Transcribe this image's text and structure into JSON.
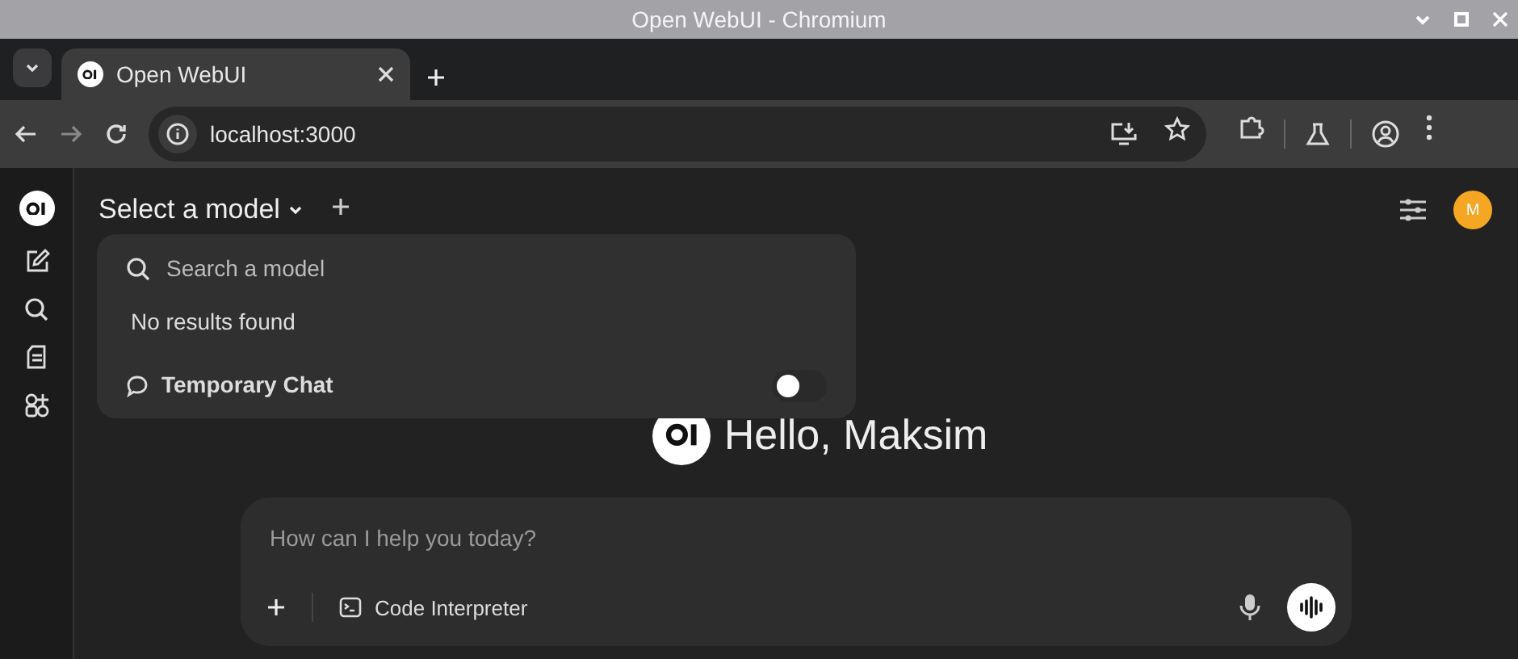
{
  "window": {
    "title": "Open WebUI - Chromium"
  },
  "tabs": [
    {
      "label": "Open WebUI",
      "selected": true
    }
  ],
  "address_bar": {
    "url": "localhost:3000"
  },
  "sidebar": {
    "items": [
      {
        "kind": "new-chat"
      },
      {
        "kind": "search"
      },
      {
        "kind": "notes"
      },
      {
        "kind": "workspace"
      }
    ]
  },
  "header": {
    "model_selector": "Select a model",
    "avatar": "M"
  },
  "model_menu": {
    "search": {
      "placeholder": "Search a model"
    },
    "message": "No results found",
    "temporary_chat": {
      "label": "Temporary Chat",
      "on": false
    }
  },
  "greeting": "Hello, Maksim",
  "composer": {
    "placeholder": "How can I help you today?",
    "tool": "Code Interpreter"
  }
}
